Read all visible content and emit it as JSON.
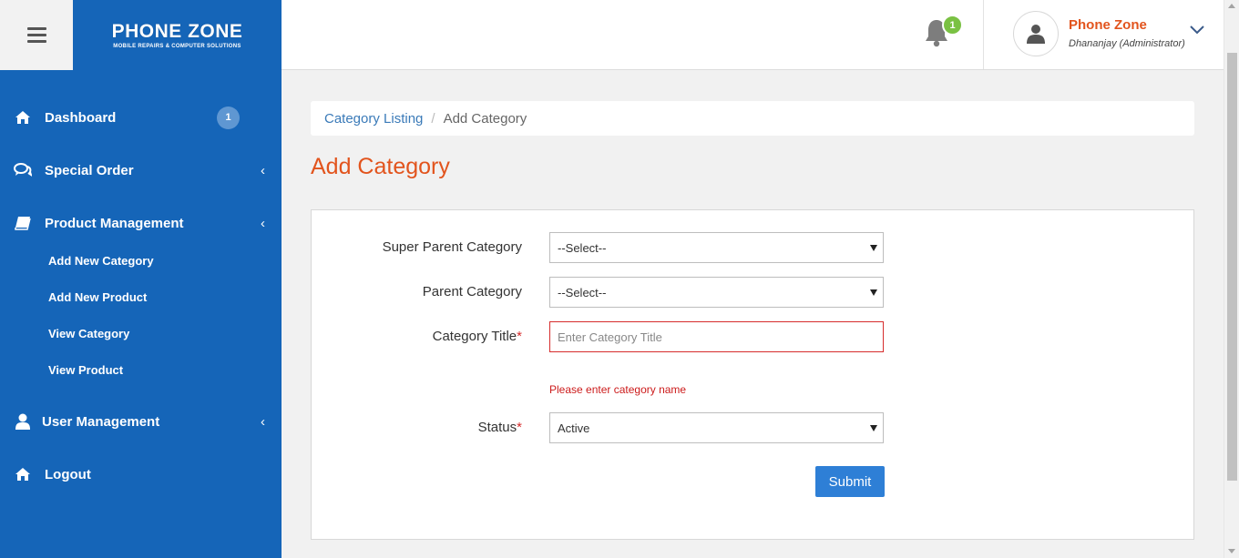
{
  "colors": {
    "brand_blue": "#1565b8",
    "accent_orange": "#e2541d",
    "error_red": "#cc1b1b",
    "badge_green": "#7ac143",
    "button_blue": "#2e7fd6"
  },
  "header": {
    "logo_text": "PHONE ZONE",
    "logo_tagline": "MOBILE REPAIRS & COMPUTER SOLUTIONS",
    "notification_count": "1",
    "user": {
      "name": "Phone Zone",
      "role": "Dhananjay (Administrator)"
    }
  },
  "sidebar": {
    "items": [
      {
        "label": "Dashboard",
        "icon": "home-icon",
        "badge": "1"
      },
      {
        "label": "Special Order",
        "icon": "comments-icon",
        "caret": "‹"
      },
      {
        "label": "Product Management",
        "icon": "book-icon",
        "caret": "‹",
        "subitems": [
          "Add New Category",
          "Add New Product",
          "View Category",
          "View Product"
        ]
      },
      {
        "label": "User Management",
        "icon": "user-icon",
        "caret": "‹"
      },
      {
        "label": "Logout",
        "icon": "home-icon"
      }
    ]
  },
  "breadcrumb": {
    "link": "Category Listing",
    "separator": "/",
    "current": "Add Category"
  },
  "page_title": "Add Category",
  "form": {
    "super_parent": {
      "label": "Super Parent Category",
      "value": "--Select--"
    },
    "parent": {
      "label": "Parent Category",
      "value": "--Select--"
    },
    "title": {
      "label": "Category Title",
      "required_mark": "*",
      "placeholder": "Enter Category Title",
      "value": ""
    },
    "error": "Please enter category name",
    "status": {
      "label": "Status",
      "required_mark": "*",
      "value": "Active"
    },
    "submit_label": "Submit"
  }
}
